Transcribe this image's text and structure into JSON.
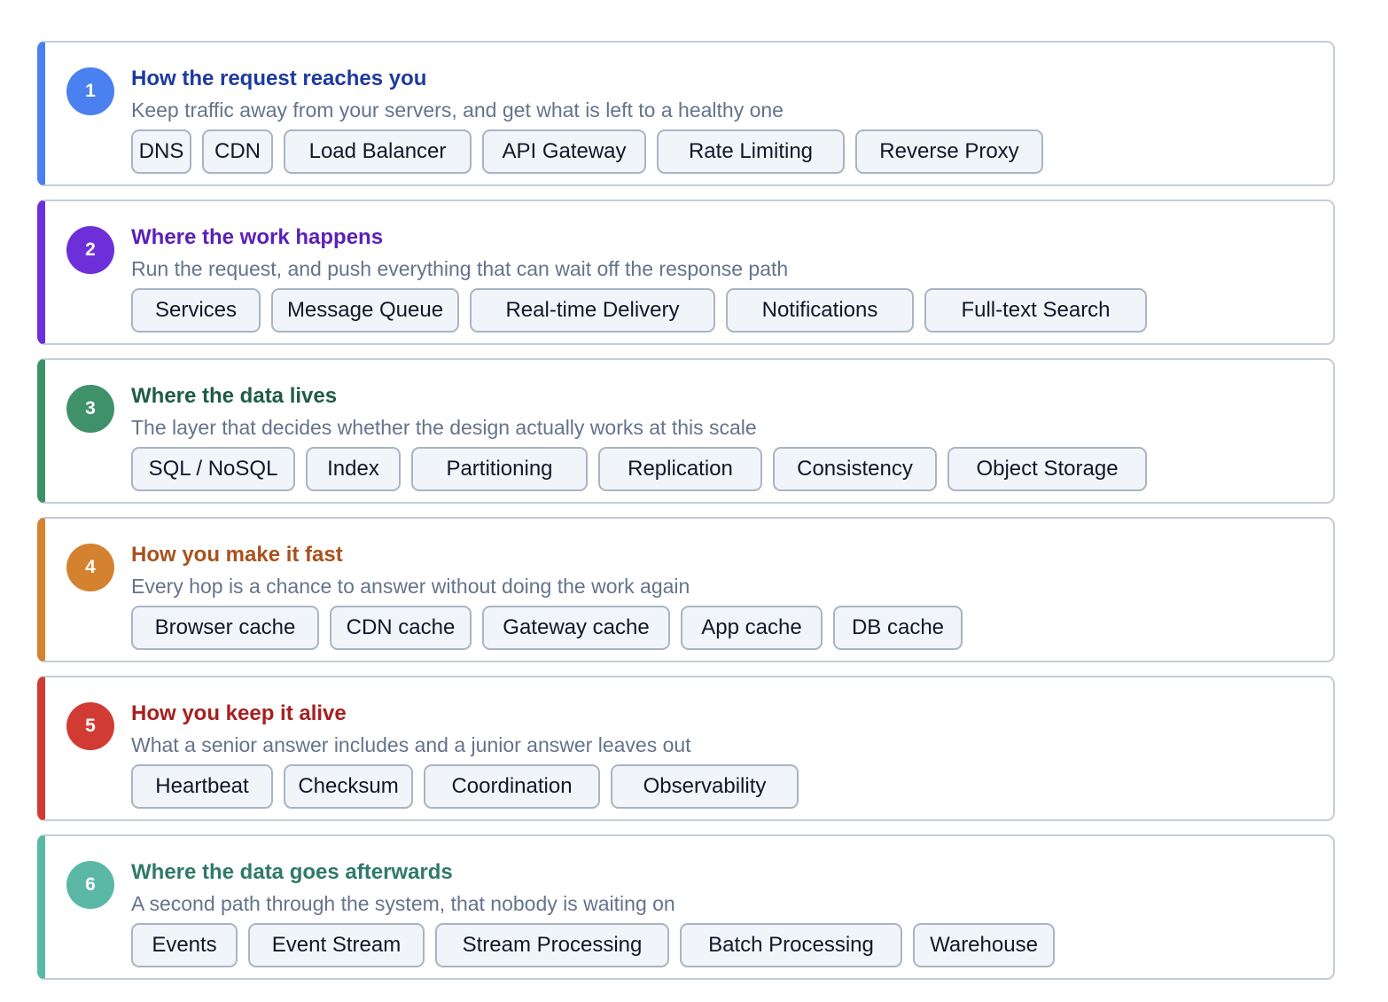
{
  "layers": [
    {
      "number": "1",
      "title": "How the request reaches you",
      "subtitle": "Keep traffic away from your servers, and get what is left to a healthy one",
      "color": "#4a80ef",
      "title_color": "#1e3a9f",
      "chips": [
        "DNS",
        "CDN",
        "Load Balancer",
        "API Gateway",
        "Rate Limiting",
        "Reverse Proxy"
      ]
    },
    {
      "number": "2",
      "title": "Where the work happens",
      "subtitle": "Run the request, and push everything that can wait off the response path",
      "color": "#6d2fd9",
      "title_color": "#5b21b6",
      "chips": [
        "Services",
        "Message Queue",
        "Real-time Delivery",
        "Notifications",
        "Full-text Search"
      ]
    },
    {
      "number": "3",
      "title": "Where the data lives",
      "subtitle": "The layer that decides whether the design actually works at this scale",
      "color": "#3f916a",
      "title_color": "#1f5c45",
      "chips": [
        "SQL / NoSQL",
        "Index",
        "Partitioning",
        "Replication",
        "Consistency",
        "Object Storage"
      ]
    },
    {
      "number": "4",
      "title": "How you make it fast",
      "subtitle": "Every hop is a chance to answer without doing the work again",
      "color": "#d4822f",
      "title_color": "#a8521c",
      "chips": [
        "Browser cache",
        "CDN cache",
        "Gateway cache",
        "App cache",
        "DB cache"
      ]
    },
    {
      "number": "5",
      "title": "How you keep it alive",
      "subtitle": "What a senior answer includes and a junior answer leaves out",
      "color": "#d23b33",
      "title_color": "#a81f1f",
      "chips": [
        "Heartbeat",
        "Checksum",
        "Coordination",
        "Observability"
      ]
    },
    {
      "number": "6",
      "title": "Where the data goes afterwards",
      "subtitle": "A second path through the system, that nobody is waiting on",
      "color": "#5bb8a6",
      "title_color": "#2f7a6a",
      "chips": [
        "Events",
        "Event Stream",
        "Stream Processing",
        "Batch Processing",
        "Warehouse"
      ]
    }
  ]
}
